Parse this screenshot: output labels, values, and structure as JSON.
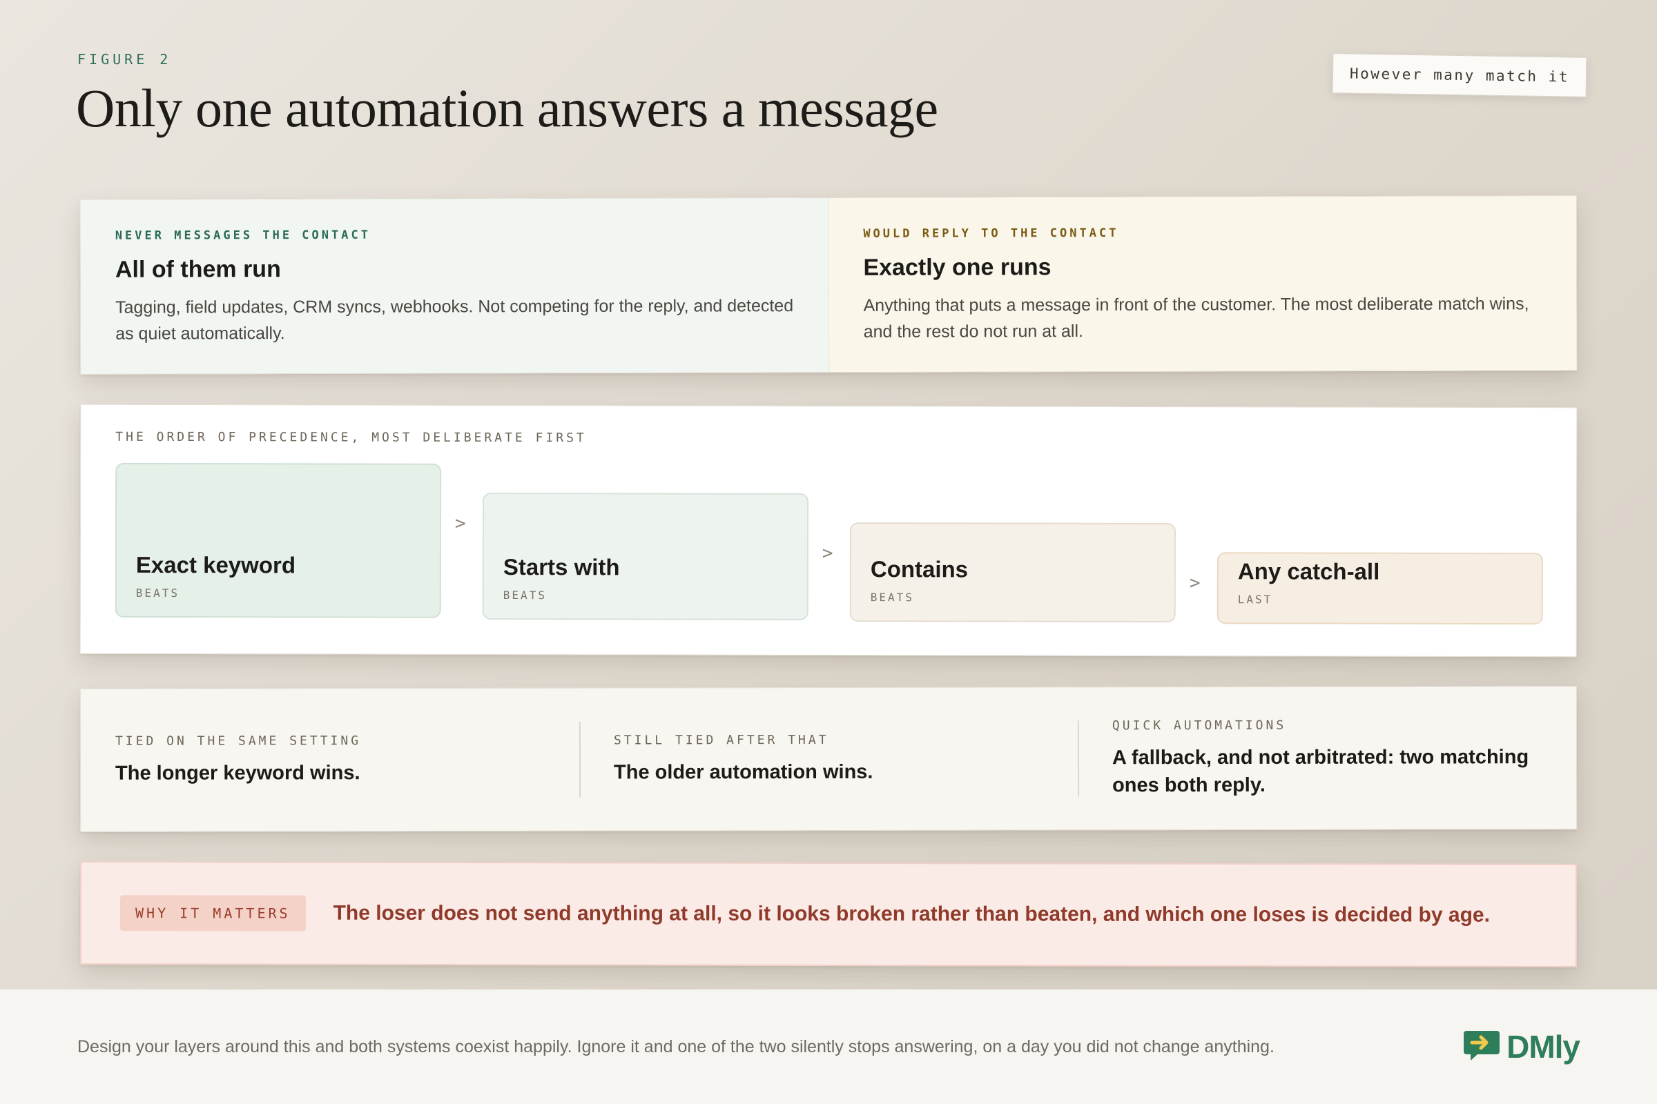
{
  "header": {
    "eyebrow": "FIGURE 2",
    "title": "Only one automation answers a message",
    "tag": "However many match it"
  },
  "split": {
    "left": {
      "label": "NEVER MESSAGES THE CONTACT",
      "heading": "All of them run",
      "body": "Tagging, field updates, CRM syncs, webhooks. Not competing for the reply, and detected as quiet automatically."
    },
    "right": {
      "label": "WOULD REPLY TO THE CONTACT",
      "heading": "Exactly one runs",
      "body": "Anything that puts a message in front of the customer. The most deliberate match wins, and the rest do not run at all."
    }
  },
  "precedence": {
    "label": "THE ORDER OF PRECEDENCE, MOST DELIBERATE FIRST",
    "chevron": ">",
    "steps": [
      {
        "name": "Exact keyword",
        "sub": "BEATS"
      },
      {
        "name": "Starts with",
        "sub": "BEATS"
      },
      {
        "name": "Contains",
        "sub": "BEATS"
      },
      {
        "name": "Any catch-all",
        "sub": "LAST"
      }
    ]
  },
  "rules": [
    {
      "label": "TIED ON THE SAME SETTING",
      "text": "The longer keyword wins."
    },
    {
      "label": "STILL TIED AFTER THAT",
      "text": "The older automation wins."
    },
    {
      "label": "QUICK AUTOMATIONS",
      "text": "A fallback, and not arbitrated: two matching ones both reply."
    }
  ],
  "callout": {
    "pill": "WHY IT MATTERS",
    "text": "The loser does not send anything at all, so it looks broken rather than beaten, and which one loses is decided by age."
  },
  "footer": {
    "note": "Design your layers around this and both systems coexist happily. Ignore it and one of the two silently stops answering, on a day you did not change anything.",
    "brand": "DMly",
    "brand_icon": "chat-arrow-icon"
  },
  "colors": {
    "accent_green": "#2e7d5b",
    "warning_red": "#8f3a2a"
  }
}
